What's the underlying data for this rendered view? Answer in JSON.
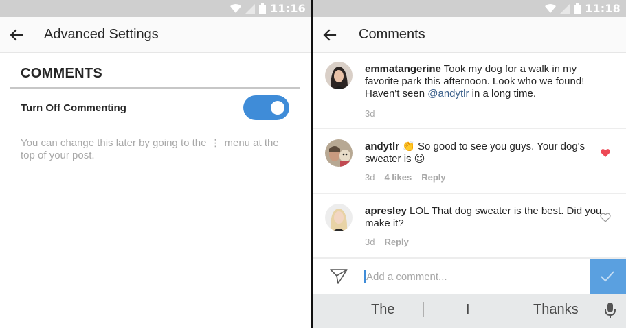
{
  "left_screen": {
    "status_bar": {
      "time": "11:16"
    },
    "app_bar": {
      "title": "Advanced Settings",
      "back_icon": "arrow-left-icon"
    },
    "section": {
      "header": "COMMENTS"
    },
    "setting": {
      "label": "Turn Off Commenting",
      "toggle_on": true
    },
    "help": {
      "text_before": "You can change this later by going to the",
      "menu_glyph": "⋮",
      "text_after": "menu at the top of your post."
    },
    "colors": {
      "accent": "#3f8cd8"
    }
  },
  "right_screen": {
    "status_bar": {
      "time": "11:18"
    },
    "app_bar": {
      "title": "Comments",
      "back_icon": "arrow-left-icon"
    },
    "comments": [
      {
        "username": "emmatangerine",
        "text_before": " Took my dog for a walk in my favorite park this afternoon. Look who we found! Haven't seen ",
        "mention": "@andytlr",
        "text_after": " in a long time.",
        "time": "3d",
        "likes": "",
        "reply": ""
      },
      {
        "username": "andytlr",
        "text_before": " 👏 So good to see you guys. Your dog's sweater is 😍",
        "mention": "",
        "text_after": "",
        "time": "3d",
        "likes": "4 likes",
        "reply": "Reply",
        "liked": true
      },
      {
        "username": "apresley",
        "text_before": " LOL That dog sweater is the best. Did you make it?",
        "mention": "",
        "text_after": "",
        "time": "3d",
        "likes": "",
        "reply": "Reply",
        "liked": false
      }
    ],
    "composer": {
      "placeholder": "Add a comment..."
    },
    "keyboard_suggestions": [
      "The",
      "I",
      "Thanks"
    ],
    "colors": {
      "heart_liked": "#ed4956",
      "post_button": "#5aa0e0"
    }
  }
}
